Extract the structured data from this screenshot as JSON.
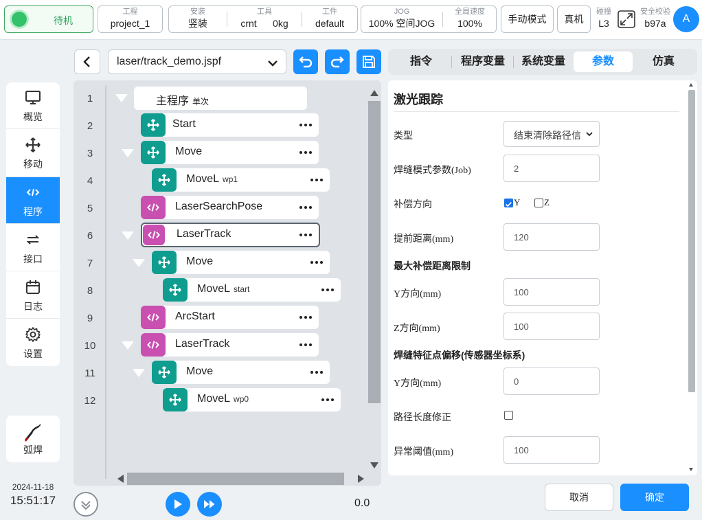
{
  "topbar": {
    "status": "待机",
    "project": {
      "label": "工程",
      "value": "project_1"
    },
    "install": {
      "label": "安装",
      "value": "竖装"
    },
    "tool": {
      "label": "工具",
      "name": "crnt",
      "weight": "0kg"
    },
    "workpiece": {
      "label": "工件",
      "value": "default"
    },
    "jog": {
      "label": "JOG",
      "value": "100%",
      "space": "空间JOG"
    },
    "speed": {
      "label": "全局速度",
      "value": "100%"
    },
    "mode_button": "手动模式",
    "robot_button": "真机",
    "collision": {
      "label": "碰撞",
      "value": "L3"
    },
    "checksum": {
      "label": "安全校验",
      "value": "b97a"
    },
    "avatar": "A"
  },
  "nav": {
    "items": [
      {
        "label": "概览",
        "icon": "monitor-icon"
      },
      {
        "label": "移动",
        "icon": "move-icon"
      },
      {
        "label": "程序",
        "icon": "code-icon"
      },
      {
        "label": "接口",
        "icon": "interface-icon"
      },
      {
        "label": "日志",
        "icon": "calendar-icon"
      },
      {
        "label": "设置",
        "icon": "gear-icon"
      }
    ],
    "active_index": 2,
    "weld": {
      "label": "弧焊",
      "icon": "welding-torch-icon"
    },
    "date": "2024-11-18",
    "time": "15:51:17"
  },
  "program": {
    "file": "laser/track_demo.jspf",
    "line_numbers": [
      "1",
      "2",
      "3",
      "4",
      "5",
      "6",
      "7",
      "8",
      "9",
      "10",
      "11",
      "12"
    ],
    "main": {
      "name": "主程序",
      "tag": "单次"
    },
    "nodes": [
      {
        "name": "Start",
        "arg": ""
      },
      {
        "name": "Move",
        "arg": ""
      },
      {
        "name": "MoveL",
        "arg": "wp1"
      },
      {
        "name": "LaserSearchPose",
        "arg": ""
      },
      {
        "name": "LaserTrack",
        "arg": ""
      },
      {
        "name": "Move",
        "arg": ""
      },
      {
        "name": "MoveL",
        "arg": "start"
      },
      {
        "name": "ArcStart",
        "arg": ""
      },
      {
        "name": "LaserTrack",
        "arg": ""
      },
      {
        "name": "Move",
        "arg": ""
      },
      {
        "name": "MoveL",
        "arg": "wp0"
      }
    ],
    "speed_value": "0.0"
  },
  "tabs": {
    "items": [
      "指令",
      "程序变量",
      "系统变量",
      "参数",
      "仿真"
    ],
    "active_index": 3
  },
  "params": {
    "title": "激光跟踪",
    "type_label": "类型",
    "type_value": "结束清除路径信",
    "job_label": "焊缝模式参数(Job)",
    "job_value": "2",
    "comp_dir_label": "补偿方向",
    "comp_y": "Y",
    "comp_z": "Z",
    "advance_label": "提前距离(mm)",
    "advance_value": "120",
    "max_comp_title": "最大补偿距离限制",
    "max_y_label": "Y方向(mm)",
    "max_y_value": "100",
    "max_z_label": "Z方向(mm)",
    "max_z_value": "100",
    "offset_title": "焊缝特征点偏移(传感器坐标系)",
    "offset_y_label": "Y方向(mm)",
    "offset_y_value": "0",
    "path_len_label": "路径长度修正",
    "threshold_label": "异常阈值(mm)",
    "threshold_value": "100"
  },
  "footer": {
    "cancel": "取消",
    "ok": "确定"
  },
  "colors": {
    "accent": "#1a8fff",
    "teal": "#0f9d8f",
    "pink": "#c94fb0",
    "status_green": "#33c26a"
  }
}
